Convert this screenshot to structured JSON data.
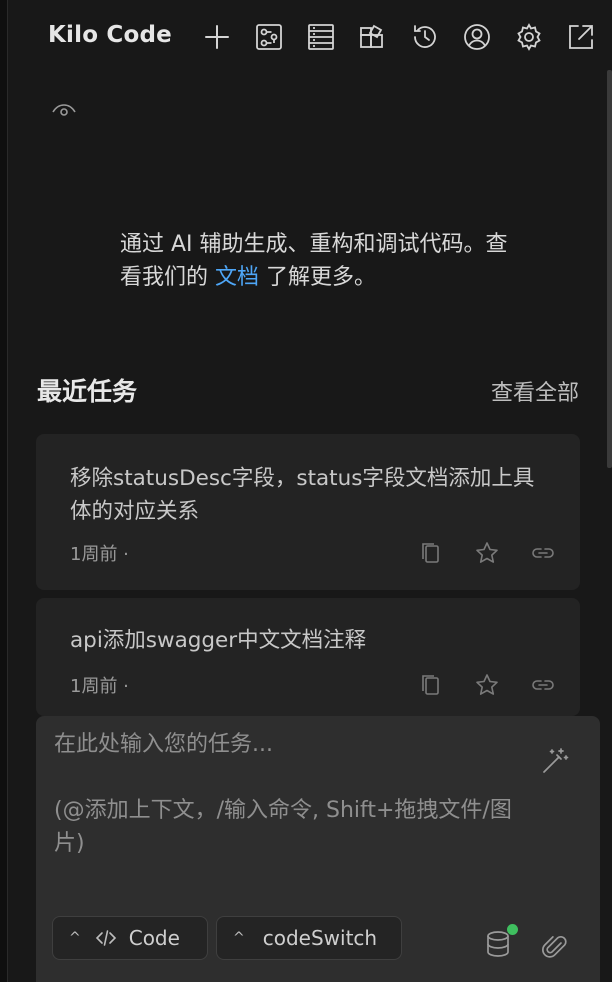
{
  "header": {
    "title": "Kilo Code",
    "icons": [
      "plus-icon",
      "mcp-servers-icon",
      "prompts-icon",
      "marketplace-icon",
      "history-icon",
      "account-icon",
      "settings-icon",
      "popout-icon"
    ]
  },
  "intro": {
    "text_before": "通过 AI 辅助生成、重构和调试代码。查看我们的 ",
    "link": "文档",
    "text_after": " 了解更多。"
  },
  "recent": {
    "title": "最近任务",
    "view_all": "查看全部",
    "tasks": [
      {
        "text": "移除statusDesc字段，status字段文档添加上具体的对应关系",
        "time": "1周前 ·"
      },
      {
        "text": "api添加swagger中文文档注释",
        "time": "1周前 ·"
      }
    ]
  },
  "composer": {
    "placeholder": "在此处输入您的任务...\n\n(@添加上下文，/输入命令, Shift+拖拽文件/图片)",
    "mode_label": "Code",
    "config_label": "codeSwitch"
  },
  "colors": {
    "background": "#181818",
    "card": "#232323",
    "composer": "#2e2e2e",
    "link": "#4ea6f7",
    "status_dot": "#3fbf5f"
  }
}
